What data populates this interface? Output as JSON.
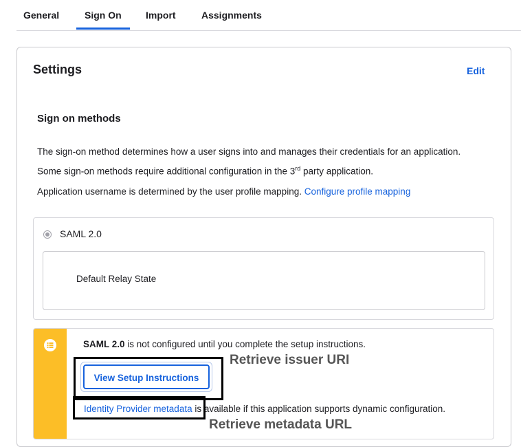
{
  "tabs": [
    {
      "label": "General"
    },
    {
      "label": "Sign On",
      "active": true
    },
    {
      "label": "Import"
    },
    {
      "label": "Assignments"
    }
  ],
  "settings": {
    "title": "Settings",
    "edit_label": "Edit"
  },
  "sign_on": {
    "section_title": "Sign on methods",
    "desc_line1": "The sign-on method determines how a user signs into and manages their credentials for an application.",
    "desc_line2_pre": "Some sign-on methods require additional configuration in the 3",
    "desc_line2_sup": "rd",
    "desc_line2_post": " party application.",
    "username_text": "Application username is determined by the user profile mapping.",
    "configure_link": "Configure profile mapping"
  },
  "saml": {
    "option_label": "SAML 2.0",
    "relay_label": "Default Relay State"
  },
  "callout": {
    "bold_text": "SAML 2.0",
    "text": " is not configured until you complete the setup instructions.",
    "setup_button": "View Setup Instructions",
    "idp_link": "Identity Provider metadata",
    "idp_text": " is available if this application supports dynamic configuration.",
    "accent_color": "#fcbe27"
  },
  "annotations": {
    "issuer": "Retrieve issuer URI",
    "metadata": "Retrieve metadata URL"
  },
  "colors": {
    "link": "#1662dd"
  }
}
